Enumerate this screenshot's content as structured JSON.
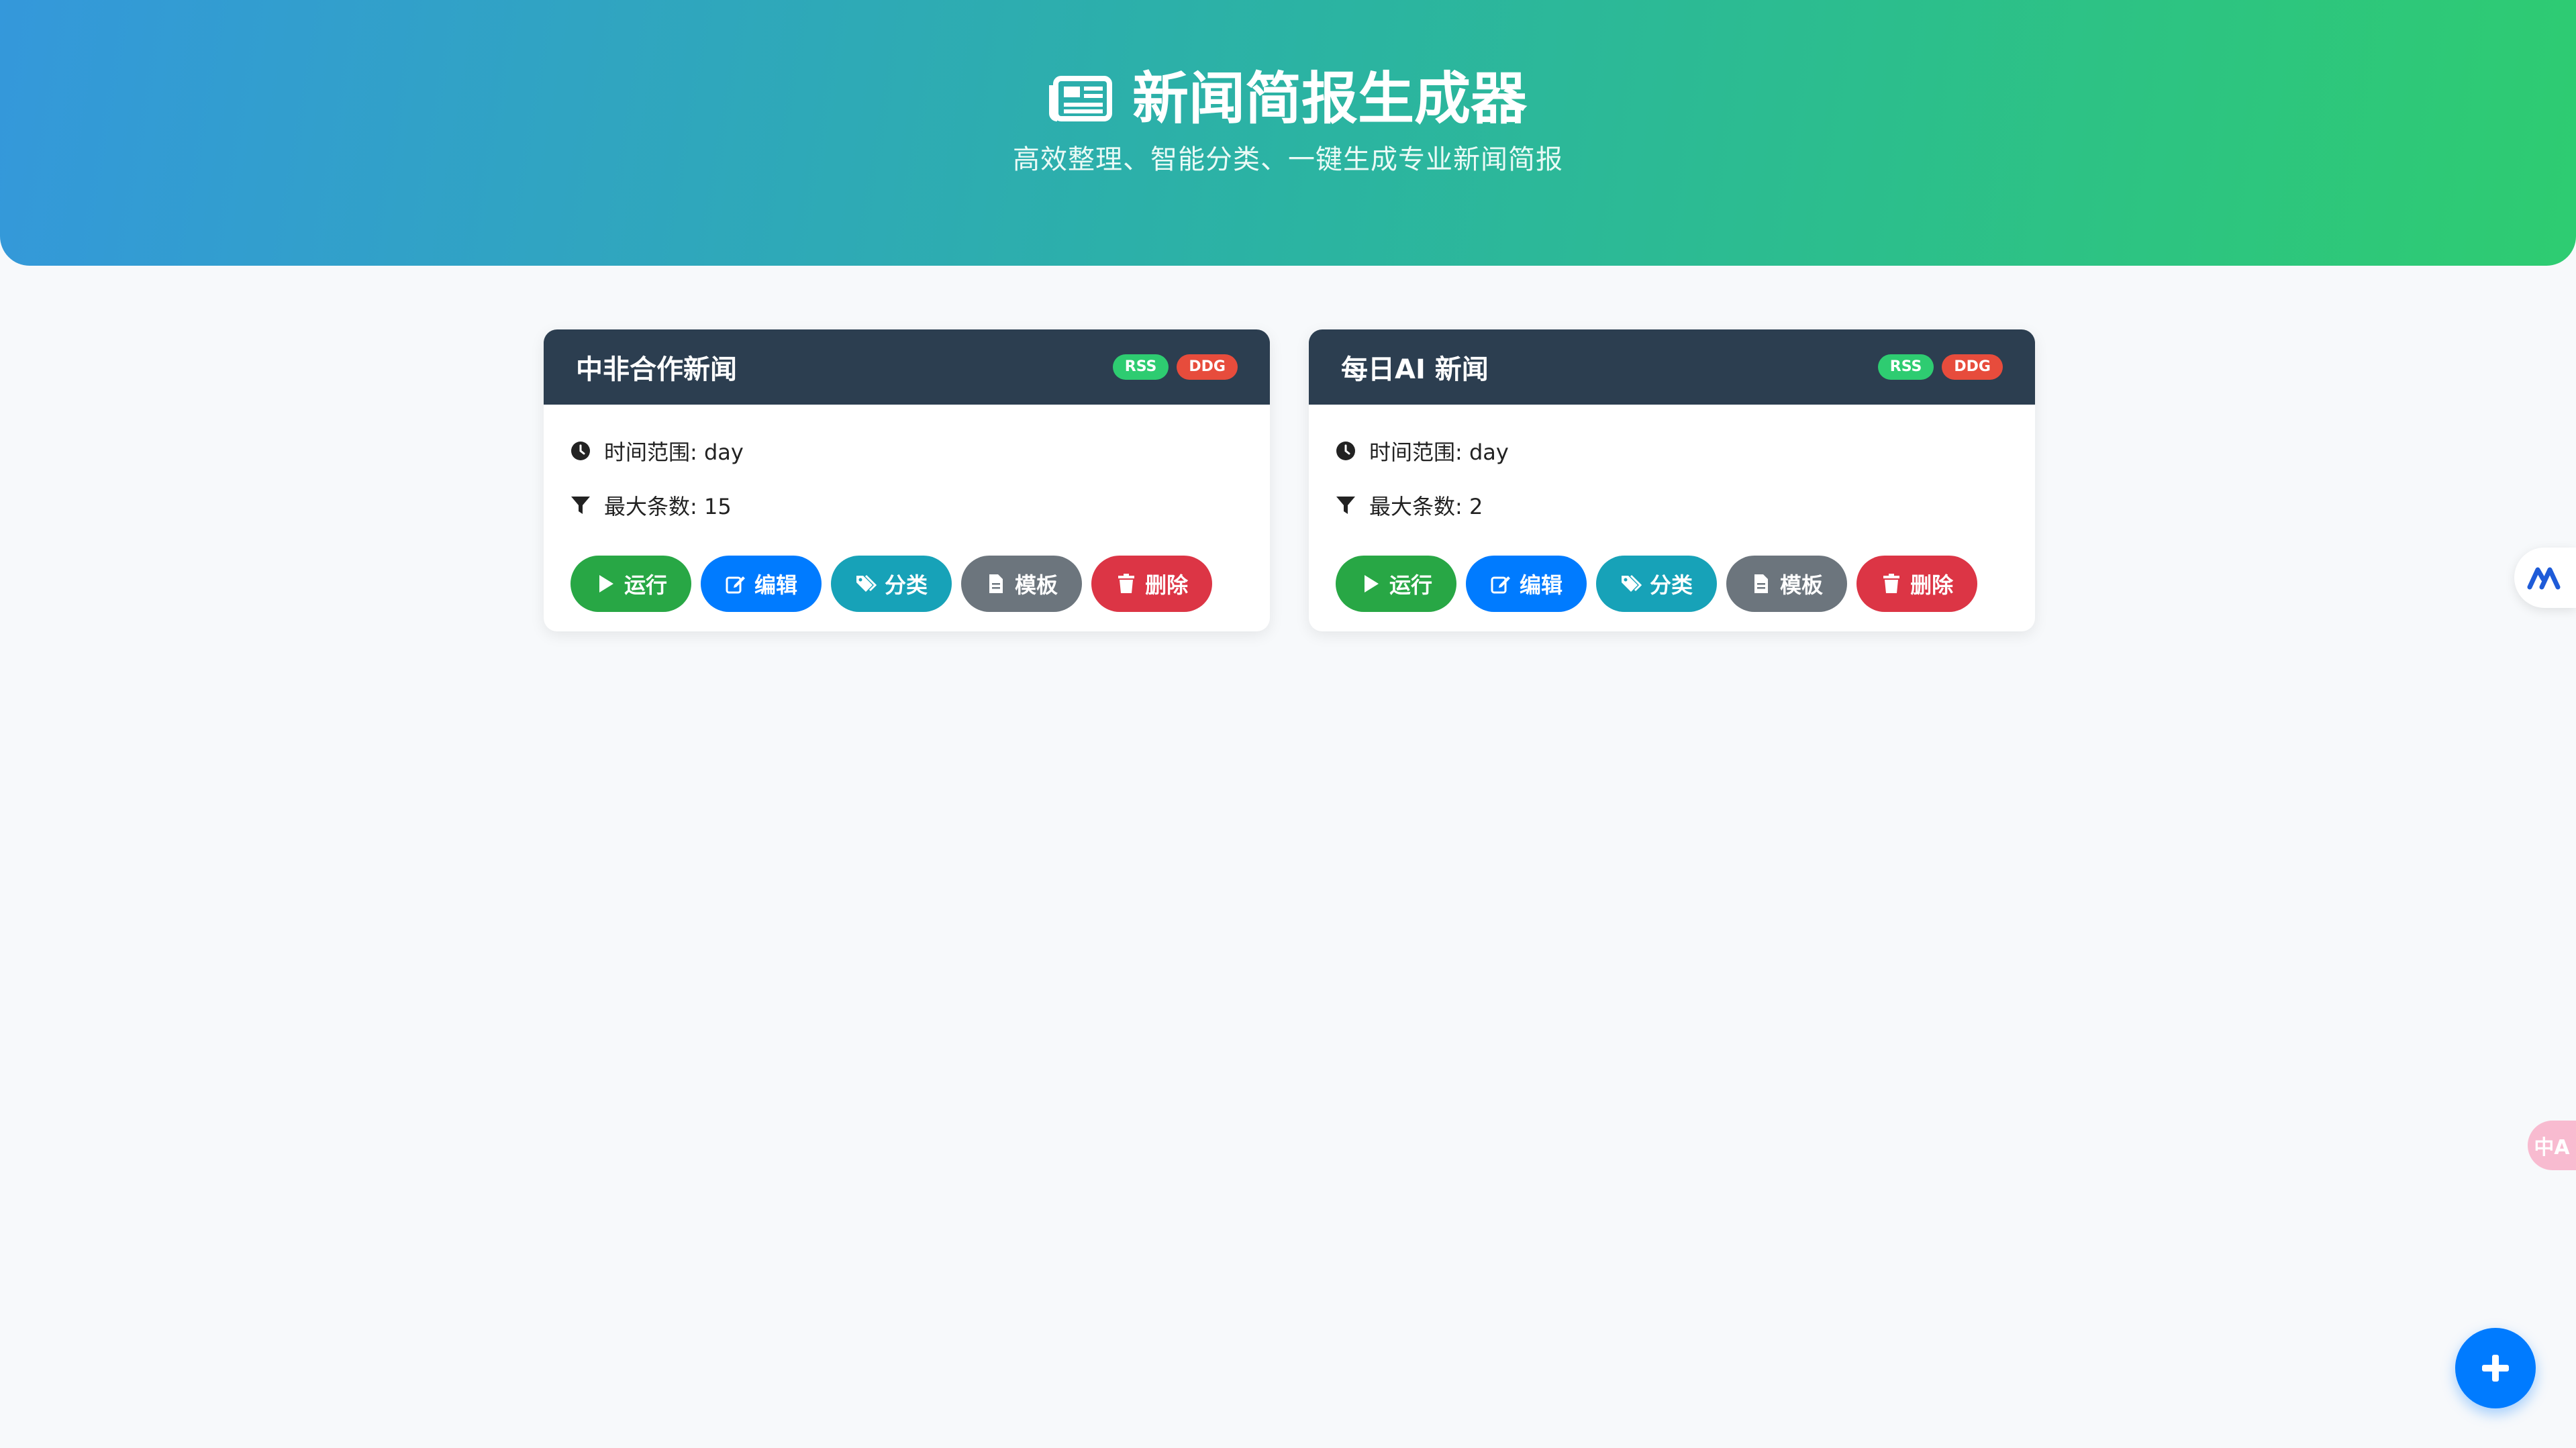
{
  "header": {
    "title": "新闻简报生成器",
    "subtitle": "高效整理、智能分类、一键生成专业新闻简报",
    "icon": "newspaper-icon"
  },
  "colors": {
    "header_gradient": [
      "#3498db",
      "#2ecc71"
    ],
    "card_header": "#2c3e50",
    "rss_badge": "#2ecc71",
    "ddg_badge": "#e74c3c",
    "run": "#28a745",
    "edit": "#007bff",
    "category": "#17a2b8",
    "template": "#6c757d",
    "delete": "#dc3545"
  },
  "cards": [
    {
      "title": "中非合作新闻",
      "badges": [
        "RSS",
        "DDG"
      ],
      "time_range": "时间范围: day",
      "max_items": "最大条数: 15"
    },
    {
      "title": "每日AI 新闻",
      "badges": [
        "RSS",
        "DDG"
      ],
      "time_range": "时间范围: day",
      "max_items": "最大条数: 2"
    }
  ],
  "actions": {
    "run": "运行",
    "edit": "编辑",
    "category": "分类",
    "template": "模板",
    "delete": "删除"
  },
  "side": {
    "translate_label": "中A"
  },
  "fab": {
    "icon": "plus-icon"
  }
}
